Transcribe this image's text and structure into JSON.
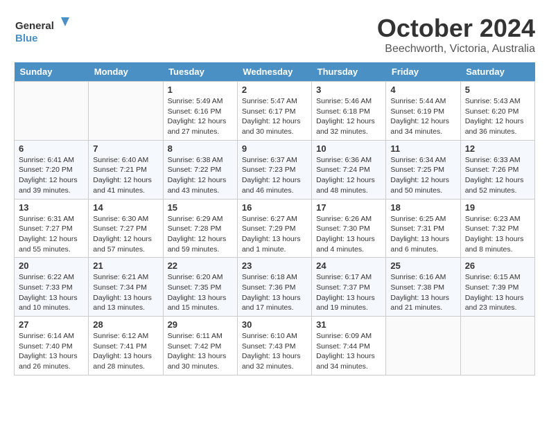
{
  "header": {
    "logo_line1": "General",
    "logo_line2": "Blue",
    "month": "October 2024",
    "location": "Beechworth, Victoria, Australia"
  },
  "weekdays": [
    "Sunday",
    "Monday",
    "Tuesday",
    "Wednesday",
    "Thursday",
    "Friday",
    "Saturday"
  ],
  "weeks": [
    [
      {
        "day": "",
        "sunrise": "",
        "sunset": "",
        "daylight": ""
      },
      {
        "day": "",
        "sunrise": "",
        "sunset": "",
        "daylight": ""
      },
      {
        "day": "1",
        "sunrise": "Sunrise: 5:49 AM",
        "sunset": "Sunset: 6:16 PM",
        "daylight": "Daylight: 12 hours and 27 minutes."
      },
      {
        "day": "2",
        "sunrise": "Sunrise: 5:47 AM",
        "sunset": "Sunset: 6:17 PM",
        "daylight": "Daylight: 12 hours and 30 minutes."
      },
      {
        "day": "3",
        "sunrise": "Sunrise: 5:46 AM",
        "sunset": "Sunset: 6:18 PM",
        "daylight": "Daylight: 12 hours and 32 minutes."
      },
      {
        "day": "4",
        "sunrise": "Sunrise: 5:44 AM",
        "sunset": "Sunset: 6:19 PM",
        "daylight": "Daylight: 12 hours and 34 minutes."
      },
      {
        "day": "5",
        "sunrise": "Sunrise: 5:43 AM",
        "sunset": "Sunset: 6:20 PM",
        "daylight": "Daylight: 12 hours and 36 minutes."
      }
    ],
    [
      {
        "day": "6",
        "sunrise": "Sunrise: 6:41 AM",
        "sunset": "Sunset: 7:20 PM",
        "daylight": "Daylight: 12 hours and 39 minutes."
      },
      {
        "day": "7",
        "sunrise": "Sunrise: 6:40 AM",
        "sunset": "Sunset: 7:21 PM",
        "daylight": "Daylight: 12 hours and 41 minutes."
      },
      {
        "day": "8",
        "sunrise": "Sunrise: 6:38 AM",
        "sunset": "Sunset: 7:22 PM",
        "daylight": "Daylight: 12 hours and 43 minutes."
      },
      {
        "day": "9",
        "sunrise": "Sunrise: 6:37 AM",
        "sunset": "Sunset: 7:23 PM",
        "daylight": "Daylight: 12 hours and 46 minutes."
      },
      {
        "day": "10",
        "sunrise": "Sunrise: 6:36 AM",
        "sunset": "Sunset: 7:24 PM",
        "daylight": "Daylight: 12 hours and 48 minutes."
      },
      {
        "day": "11",
        "sunrise": "Sunrise: 6:34 AM",
        "sunset": "Sunset: 7:25 PM",
        "daylight": "Daylight: 12 hours and 50 minutes."
      },
      {
        "day": "12",
        "sunrise": "Sunrise: 6:33 AM",
        "sunset": "Sunset: 7:26 PM",
        "daylight": "Daylight: 12 hours and 52 minutes."
      }
    ],
    [
      {
        "day": "13",
        "sunrise": "Sunrise: 6:31 AM",
        "sunset": "Sunset: 7:27 PM",
        "daylight": "Daylight: 12 hours and 55 minutes."
      },
      {
        "day": "14",
        "sunrise": "Sunrise: 6:30 AM",
        "sunset": "Sunset: 7:27 PM",
        "daylight": "Daylight: 12 hours and 57 minutes."
      },
      {
        "day": "15",
        "sunrise": "Sunrise: 6:29 AM",
        "sunset": "Sunset: 7:28 PM",
        "daylight": "Daylight: 12 hours and 59 minutes."
      },
      {
        "day": "16",
        "sunrise": "Sunrise: 6:27 AM",
        "sunset": "Sunset: 7:29 PM",
        "daylight": "Daylight: 13 hours and 1 minute."
      },
      {
        "day": "17",
        "sunrise": "Sunrise: 6:26 AM",
        "sunset": "Sunset: 7:30 PM",
        "daylight": "Daylight: 13 hours and 4 minutes."
      },
      {
        "day": "18",
        "sunrise": "Sunrise: 6:25 AM",
        "sunset": "Sunset: 7:31 PM",
        "daylight": "Daylight: 13 hours and 6 minutes."
      },
      {
        "day": "19",
        "sunrise": "Sunrise: 6:23 AM",
        "sunset": "Sunset: 7:32 PM",
        "daylight": "Daylight: 13 hours and 8 minutes."
      }
    ],
    [
      {
        "day": "20",
        "sunrise": "Sunrise: 6:22 AM",
        "sunset": "Sunset: 7:33 PM",
        "daylight": "Daylight: 13 hours and 10 minutes."
      },
      {
        "day": "21",
        "sunrise": "Sunrise: 6:21 AM",
        "sunset": "Sunset: 7:34 PM",
        "daylight": "Daylight: 13 hours and 13 minutes."
      },
      {
        "day": "22",
        "sunrise": "Sunrise: 6:20 AM",
        "sunset": "Sunset: 7:35 PM",
        "daylight": "Daylight: 13 hours and 15 minutes."
      },
      {
        "day": "23",
        "sunrise": "Sunrise: 6:18 AM",
        "sunset": "Sunset: 7:36 PM",
        "daylight": "Daylight: 13 hours and 17 minutes."
      },
      {
        "day": "24",
        "sunrise": "Sunrise: 6:17 AM",
        "sunset": "Sunset: 7:37 PM",
        "daylight": "Daylight: 13 hours and 19 minutes."
      },
      {
        "day": "25",
        "sunrise": "Sunrise: 6:16 AM",
        "sunset": "Sunset: 7:38 PM",
        "daylight": "Daylight: 13 hours and 21 minutes."
      },
      {
        "day": "26",
        "sunrise": "Sunrise: 6:15 AM",
        "sunset": "Sunset: 7:39 PM",
        "daylight": "Daylight: 13 hours and 23 minutes."
      }
    ],
    [
      {
        "day": "27",
        "sunrise": "Sunrise: 6:14 AM",
        "sunset": "Sunset: 7:40 PM",
        "daylight": "Daylight: 13 hours and 26 minutes."
      },
      {
        "day": "28",
        "sunrise": "Sunrise: 6:12 AM",
        "sunset": "Sunset: 7:41 PM",
        "daylight": "Daylight: 13 hours and 28 minutes."
      },
      {
        "day": "29",
        "sunrise": "Sunrise: 6:11 AM",
        "sunset": "Sunset: 7:42 PM",
        "daylight": "Daylight: 13 hours and 30 minutes."
      },
      {
        "day": "30",
        "sunrise": "Sunrise: 6:10 AM",
        "sunset": "Sunset: 7:43 PM",
        "daylight": "Daylight: 13 hours and 32 minutes."
      },
      {
        "day": "31",
        "sunrise": "Sunrise: 6:09 AM",
        "sunset": "Sunset: 7:44 PM",
        "daylight": "Daylight: 13 hours and 34 minutes."
      },
      {
        "day": "",
        "sunrise": "",
        "sunset": "",
        "daylight": ""
      },
      {
        "day": "",
        "sunrise": "",
        "sunset": "",
        "daylight": ""
      }
    ]
  ]
}
